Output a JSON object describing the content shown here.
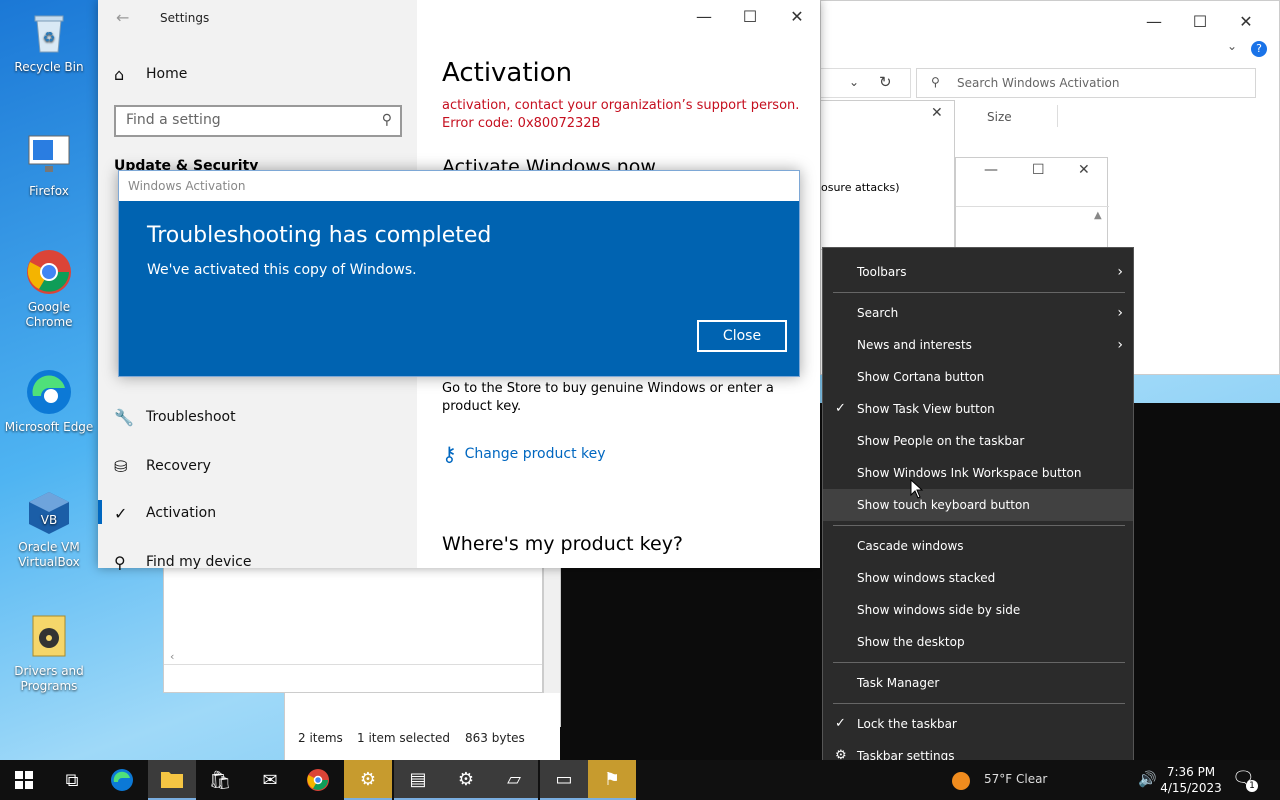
{
  "desktop": {
    "icons": [
      {
        "label": "Recycle Bin"
      },
      {
        "label": "Firefox"
      },
      {
        "label": "Google Chrome"
      },
      {
        "label": "Microsoft Edge"
      },
      {
        "label": "Oracle VM VirtualBox"
      },
      {
        "label": "Drivers and Programs"
      }
    ]
  },
  "explorer": {
    "search_placeholder": "Search Windows Activation",
    "column_size": "Size",
    "partial_text": "osure attacks)",
    "status_items": "2 items",
    "status_selected": "1 item selected",
    "status_size": "863 bytes"
  },
  "settings": {
    "title": "Settings",
    "home": "Home",
    "find_placeholder": "Find a setting",
    "section": "Update & Security",
    "nav": [
      "Troubleshoot",
      "Recovery",
      "Activation",
      "Find my device"
    ],
    "page_title": "Activation",
    "error_line1": "activation, contact your organization’s support person.",
    "error_line2": "Error code: 0x8007232B",
    "activate_heading": "Activate Windows now",
    "store_text": "Go to the Store to buy genuine Windows or enter a product key.",
    "change_key": "Change product key",
    "where_key": "Where's my product key?"
  },
  "activation_dialog": {
    "title": "Windows Activation",
    "heading": "Troubleshooting has completed",
    "message": "We've activated this copy of Windows.",
    "close_label": "Close"
  },
  "context_menu": {
    "items": [
      {
        "label": "Toolbars"
      },
      {
        "label": "Search"
      },
      {
        "label": "News and interests"
      },
      {
        "label": "Show Cortana button"
      },
      {
        "label": "Show Task View button"
      },
      {
        "label": "Show People on the taskbar"
      },
      {
        "label": "Show Windows Ink Workspace button"
      },
      {
        "label": "Show touch keyboard button"
      },
      {
        "label": "Cascade windows"
      },
      {
        "label": "Show windows stacked"
      },
      {
        "label": "Show windows side by side"
      },
      {
        "label": "Show the desktop"
      },
      {
        "label": "Task Manager"
      },
      {
        "label": "Lock the taskbar"
      },
      {
        "label": "Taskbar settings"
      }
    ]
  },
  "taskbar": {
    "weather": "57°F Clear",
    "time": "7:36 PM",
    "date": "4/15/2023",
    "notification_count": "1"
  },
  "colors": {
    "dialog_blue": "#0063b1",
    "error_red": "#c50f1f",
    "link_blue": "#0067c0"
  }
}
